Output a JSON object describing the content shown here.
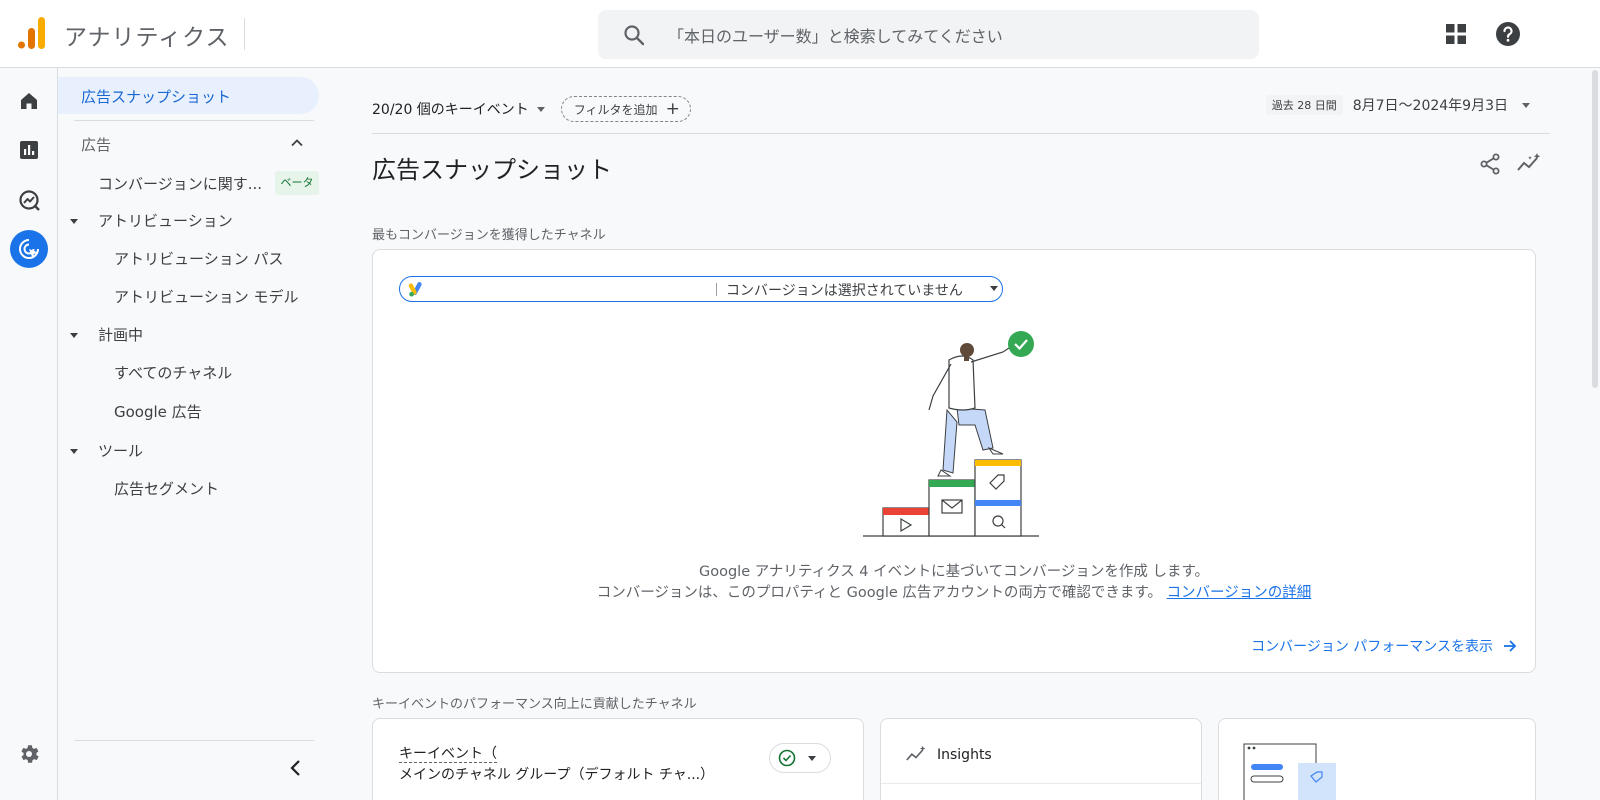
{
  "header": {
    "app_title": "アナリティクス",
    "search_placeholder": "「本日のユーザー数」と検索してみてください",
    "icons": [
      "analytics-logo",
      "search-icon",
      "apps-grid-icon",
      "help-icon"
    ]
  },
  "rail": {
    "items": [
      {
        "name": "home",
        "icon": "home-icon"
      },
      {
        "name": "reports",
        "icon": "reports-icon"
      },
      {
        "name": "explore",
        "icon": "explore-icon"
      },
      {
        "name": "advertising",
        "icon": "advertising-icon",
        "active": true
      }
    ],
    "settings_icon": "settings-icon"
  },
  "subnav": {
    "selected": "広告スナップショット",
    "section_title": "広告",
    "conversion_item": "コンバージョンに関す...",
    "beta_label": "ベータ",
    "groups": [
      {
        "label": "アトリビューション",
        "items": [
          "アトリビューション パス",
          "アトリビューション モデル"
        ]
      },
      {
        "label": "計画中",
        "items": [
          "すべてのチャネル",
          "Google 広告"
        ]
      },
      {
        "label": "ツール",
        "items": [
          "広告セグメント"
        ]
      }
    ]
  },
  "main": {
    "key_event_select": "20/20 個のキーイベント",
    "add_filter": "フィルタを追加",
    "date_badge": "過去 28 日間",
    "date_range": "8月7日～2024年9月3日",
    "page_title": "広告スナップショット",
    "section1_label": "最もコンバージョンを獲得したチャネル",
    "conversion_selector": "コンバージョンは選択されていません",
    "empty_line1": "Google アナリティクス 4 イベントに基づいてコンバージョンを作成 します。",
    "empty_line2_prefix": "コンバージョンは、このプロパティと Google 広告アカウントの両方で確認できます。",
    "empty_link": "コンバージョンの詳細",
    "view_performance": "コンバージョン パフォーマンスを表示",
    "section2_label": "キーイベントのパフォーマンス向上に貢献したチャネル",
    "key_event_card_line1": "キーイベント（",
    "key_event_card_line2": "メインのチャネル グループ（デフォルト チャ...）",
    "insights_title": "Insights"
  },
  "colors": {
    "accent": "#1a73e8",
    "selected_bg": "#e8f0fe",
    "beta_bg": "#e6f4ea",
    "beta_text": "#137333"
  }
}
